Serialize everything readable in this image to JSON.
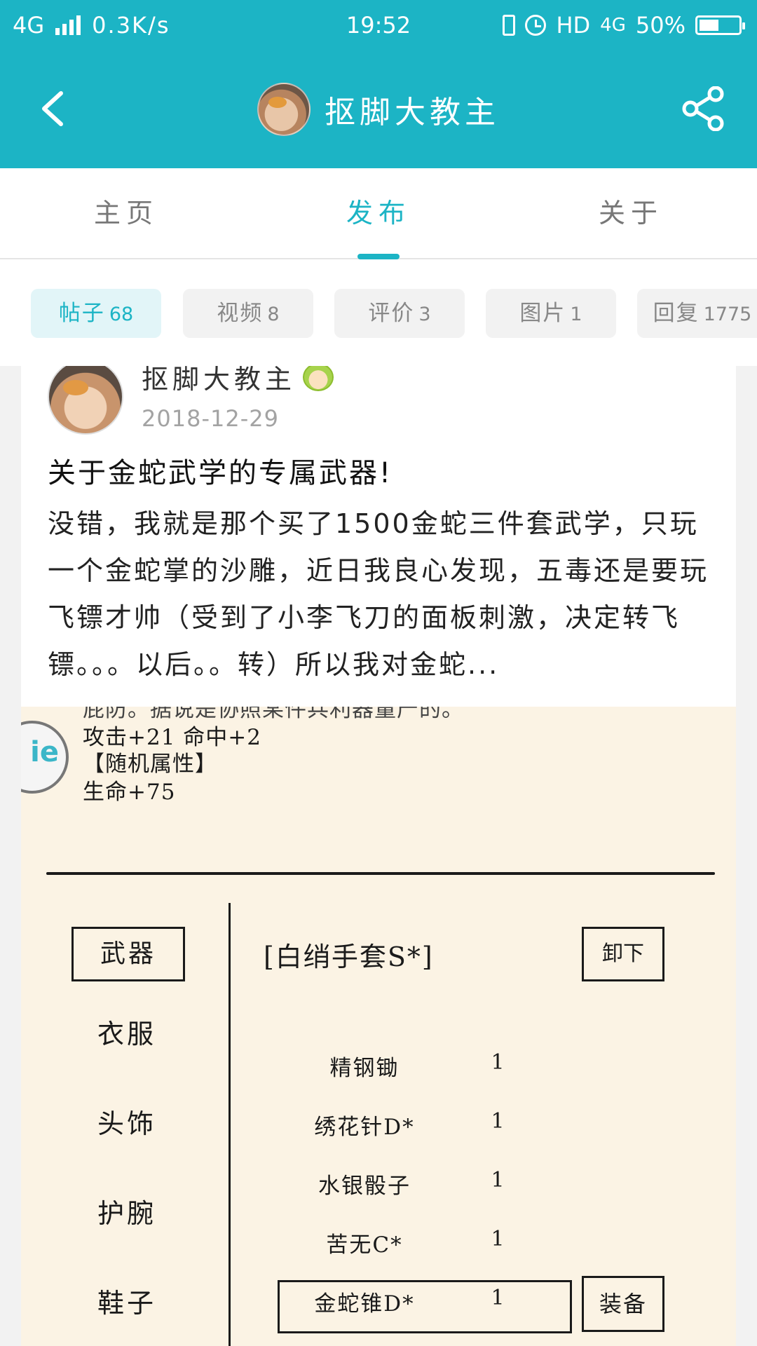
{
  "status_bar": {
    "network": "4G",
    "speed": "0.3K/s",
    "time": "19:52",
    "hd": "HD",
    "network2": "4G",
    "battery": "50%",
    "battery_level": 0.5
  },
  "header": {
    "title": "抠脚大教主",
    "back_icon": "back-arrow-icon",
    "share_icon": "share-icon",
    "accent": "#1cb4c5"
  },
  "tabs": [
    {
      "label": "主页"
    },
    {
      "label": "发布"
    },
    {
      "label": "关于"
    }
  ],
  "chips": [
    {
      "label": "帖子",
      "count": "68"
    },
    {
      "label": "视频",
      "count": "8"
    },
    {
      "label": "评价",
      "count": "3"
    },
    {
      "label": "图片",
      "count": "1"
    },
    {
      "label": "回复",
      "count": "1775"
    }
  ],
  "post": {
    "author": "抠脚大教主",
    "date": "2018-12-29",
    "title": "关于金蛇武学的专属武器!",
    "body": "没错，我就是那个买了1500金蛇三件套武学，只玩一个金蛇掌的沙雕，近日我良心发现，五毒还是要玩飞镖才帅（受到了小李飞刀的面板刺激，决定转飞镖。。。以后。。转）所以我对金蛇..."
  },
  "screenshot": {
    "cut_line": "屁防。据说是协照某件兵利器量产的。",
    "stats": [
      "攻击+21 命中+2",
      "【随机属性】",
      "生命+75"
    ],
    "slots": [
      "武器",
      "衣服",
      "头饰",
      "护腕",
      "鞋子"
    ],
    "equipped": "[白绡手套S*]",
    "unequip": "卸下",
    "items": [
      {
        "name": "精钢锄",
        "qty": "1"
      },
      {
        "name": "绣花针D*",
        "qty": "1"
      },
      {
        "name": "水银骰子",
        "qty": "1"
      },
      {
        "name": "苦无C*",
        "qty": "1"
      },
      {
        "name": "金蛇锥D*",
        "qty": "1"
      }
    ],
    "equip": "装备"
  }
}
